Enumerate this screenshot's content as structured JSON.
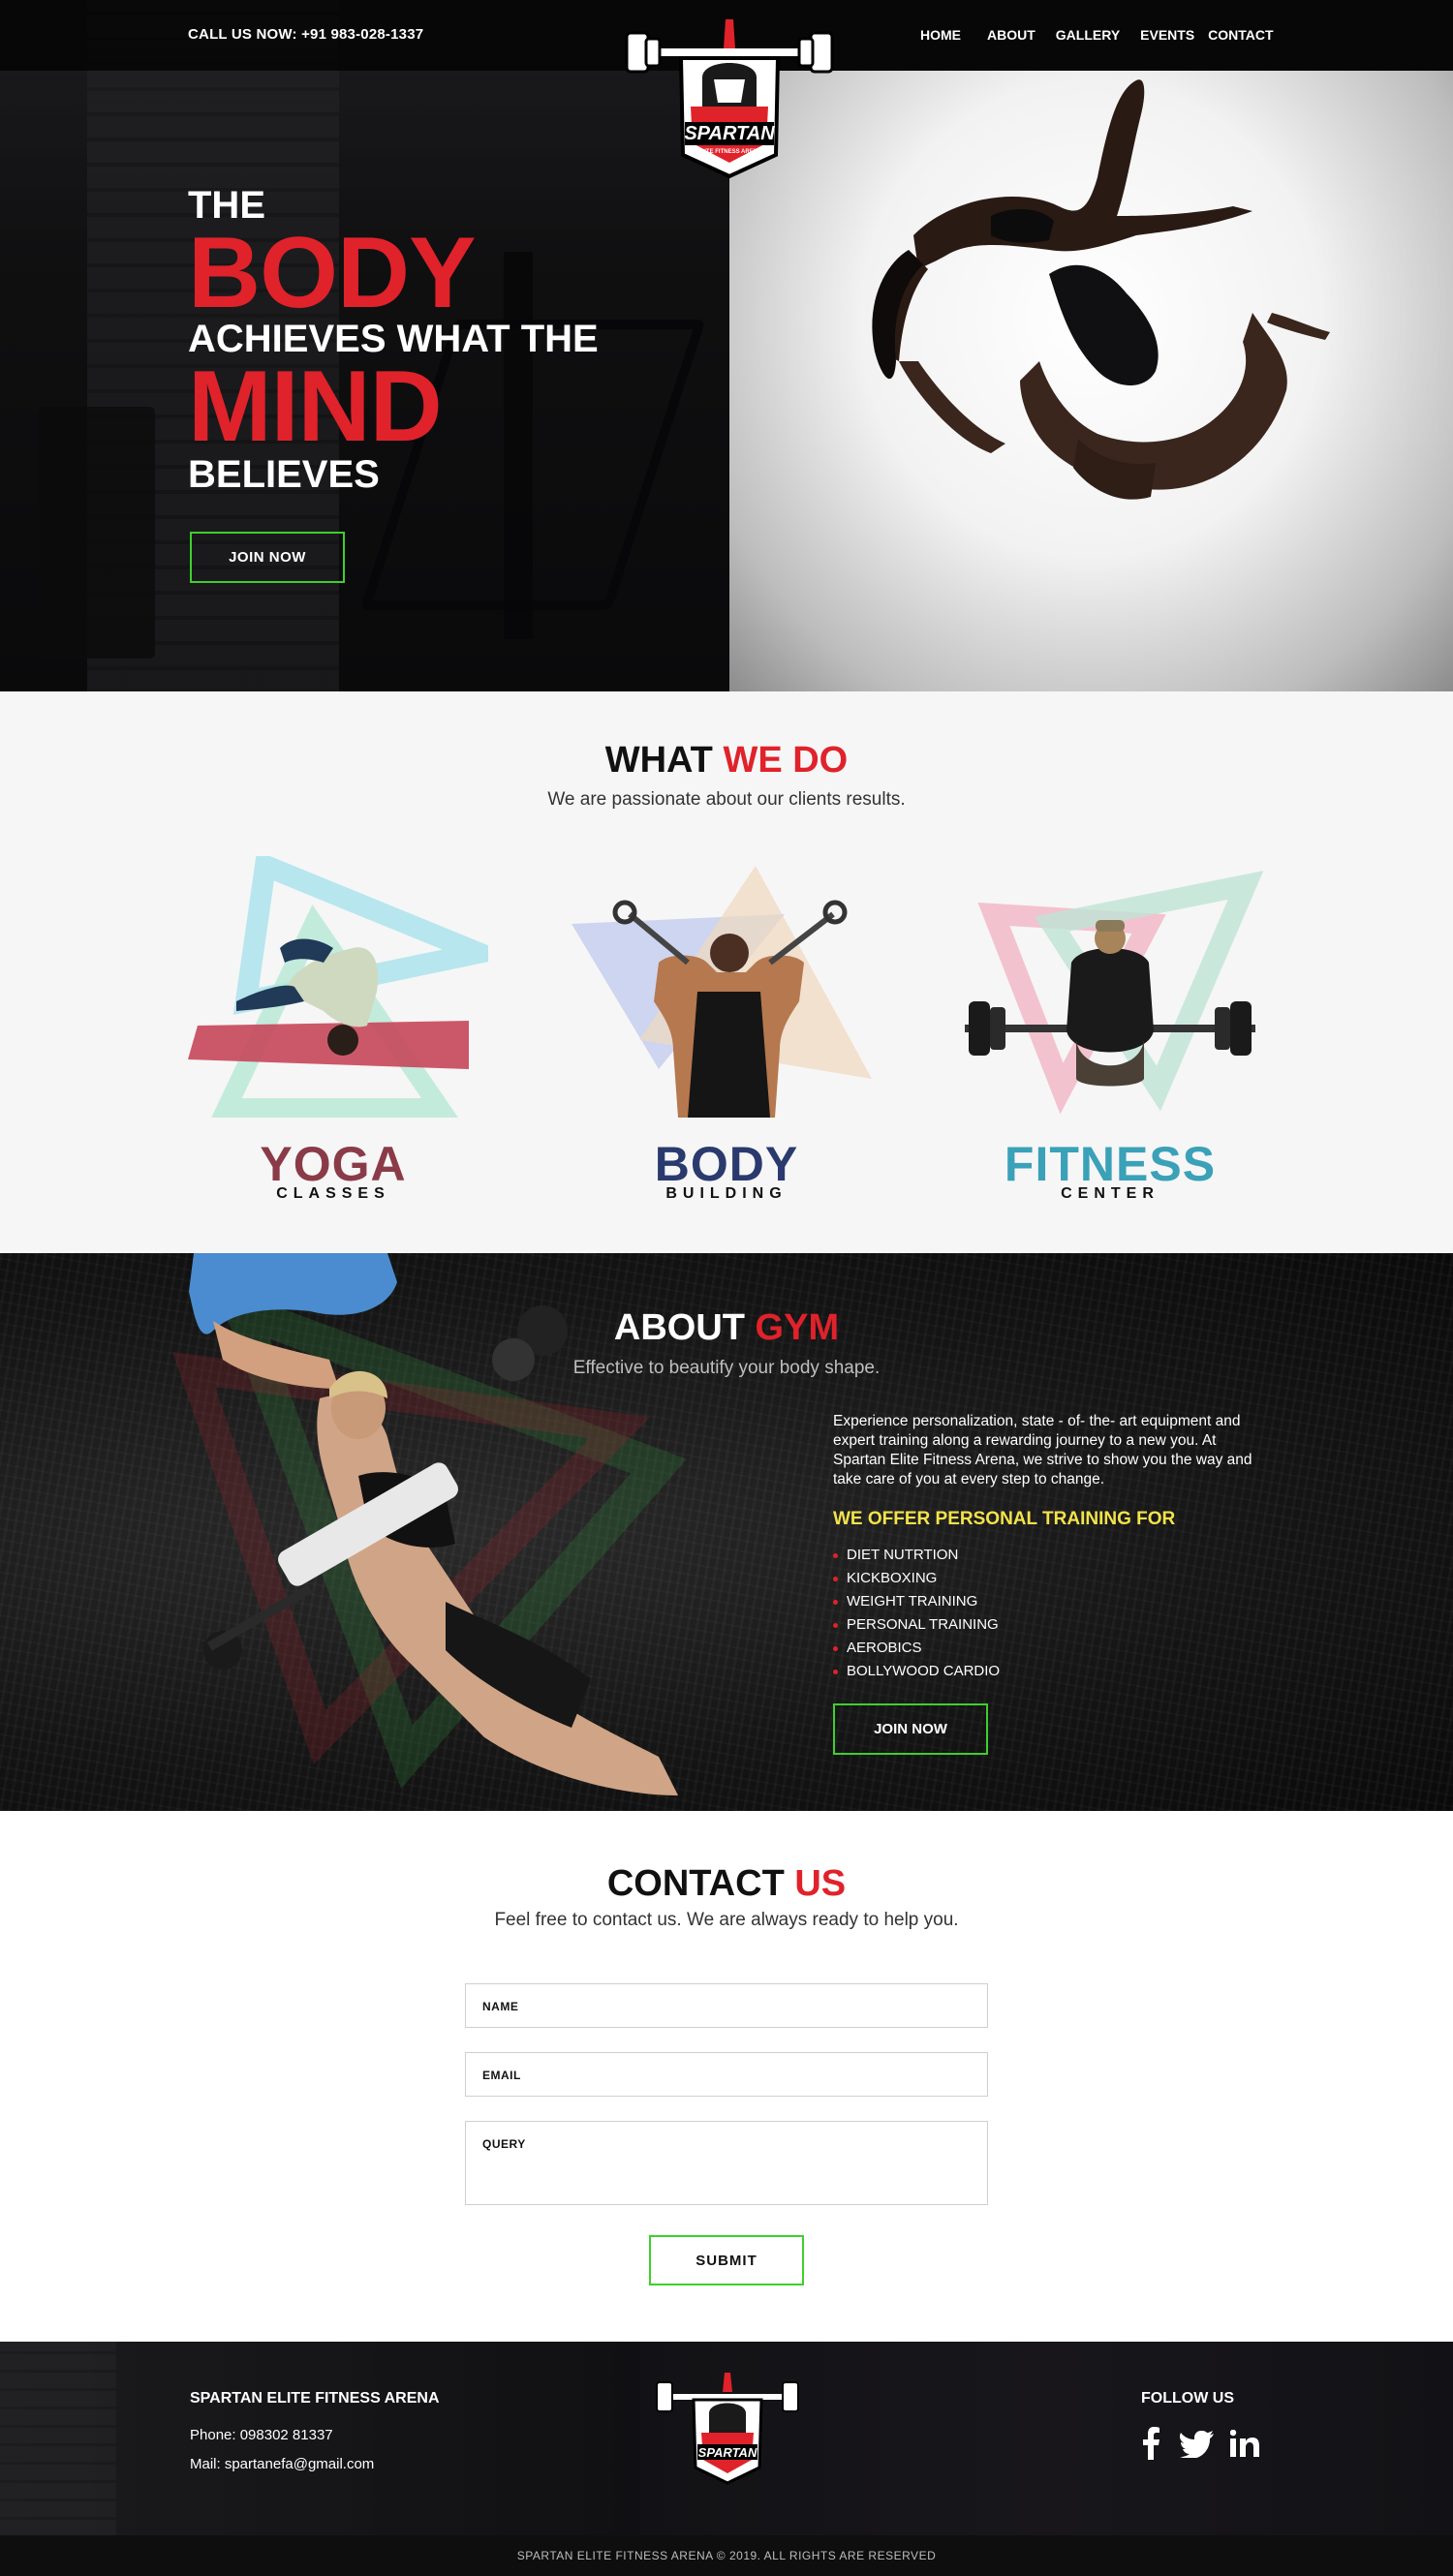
{
  "header": {
    "call_prefix": "CALL US NOW:",
    "call_number": "+91 983-028-1337",
    "nav": [
      "HOME",
      "ABOUT",
      "GALLERY",
      "EVENTS",
      "CONTACT"
    ]
  },
  "logo": {
    "text": "SPARTAN",
    "tagline": "ELITE FITNESS ARENA"
  },
  "hero": {
    "line1": "THE",
    "line2": "BODY",
    "line3": "ACHIEVES WHAT THE",
    "line4": "MIND",
    "line5": "BELIEVES",
    "cta": "JOIN NOW"
  },
  "what_we_do": {
    "title_part1": "WHAT",
    "title_part2": "WE DO",
    "subtitle": "We are passionate about our clients results.",
    "services": [
      {
        "name": "YOGA",
        "sub": "CLASSES",
        "color": "#8a3b47"
      },
      {
        "name": "BODY",
        "sub": "BUILDING",
        "color": "#2b3a6e"
      },
      {
        "name": "FITNESS",
        "sub": "CENTER",
        "color": "#3aa1b8"
      }
    ]
  },
  "about": {
    "title_part1": "ABOUT",
    "title_part2": "GYM",
    "subtitle": "Effective to beautify your body shape.",
    "paragraph": "Experience personalization, state - of- the- art equipment and expert training along a rewarding journey to a new you. At Spartan Elite Fitness Arena, we strive to show you the way and take care of you at every step to change.",
    "offer_title": "WE OFFER PERSONAL TRAINING FOR",
    "offers": [
      "DIET NUTRTION",
      "KICKBOXING",
      "WEIGHT TRAINING",
      "PERSONAL TRAINING",
      "AEROBICS",
      "BOLLYWOOD CARDIO"
    ],
    "cta": "JOIN NOW"
  },
  "contact": {
    "title_part1": "CONTACT",
    "title_part2": "US",
    "subtitle": "Feel free to contact us. We are always ready to help you.",
    "name_label": "NAME",
    "email_label": "EMAIL",
    "query_label": "QUERY",
    "submit": "SUBMIT"
  },
  "footer": {
    "brand": "SPARTAN ELITE FITNESS ARENA",
    "phone": "Phone: 098302 81337",
    "mail": "Mail: spartanefa@gmail.com",
    "follow": "FOLLOW US",
    "social_icons": [
      "facebook-icon",
      "twitter-icon",
      "linkedin-icon"
    ],
    "copyright": "SPARTAN ELITE FITNESS ARENA © 2019. ALL RIGHTS ARE RESERVED"
  },
  "colors": {
    "accent_red": "#e0222b",
    "accent_green": "#3fcf2f",
    "accent_yellow": "#f3e34a"
  }
}
